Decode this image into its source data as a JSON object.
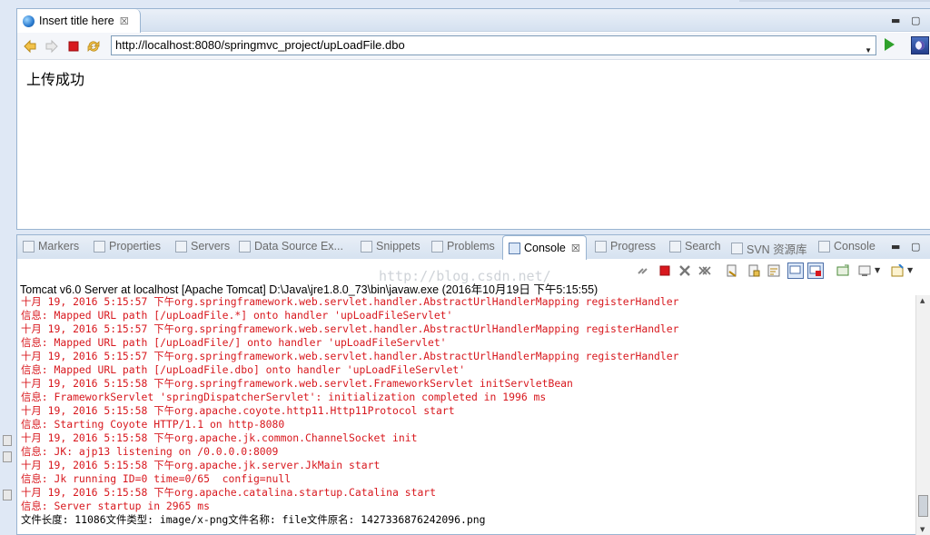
{
  "browser": {
    "tab_title": "Insert title here",
    "url": "http://localhost:8080/springmvc_project/upLoadFile.dbo",
    "page_text": "上传成功"
  },
  "views": {
    "tabs": [
      {
        "label": "Markers",
        "active": false
      },
      {
        "label": "Properties",
        "active": false
      },
      {
        "label": "Servers",
        "active": false
      },
      {
        "label": "Data Source Ex...",
        "active": false
      },
      {
        "label": "Snippets",
        "active": false
      },
      {
        "label": "Problems",
        "active": false
      },
      {
        "label": "Console",
        "active": true
      },
      {
        "label": "Progress",
        "active": false
      },
      {
        "label": "Search",
        "active": false
      },
      {
        "label": "SVN 资源库",
        "active": false
      },
      {
        "label": "Console",
        "active": false
      }
    ]
  },
  "console": {
    "header": "Tomcat v6.0 Server at localhost [Apache Tomcat] D:\\Java\\jre1.8.0_73\\bin\\javaw.exe (2016年10月19日 下午5:15:55)",
    "watermark": "http://blog.csdn.net/",
    "lines": [
      {
        "text": "十月 19, 2016 5:15:57 下午org.springframework.web.servlet.handler.AbstractUrlHandlerMapping registerHandler",
        "color": "red"
      },
      {
        "text": "信息: Mapped URL path [/upLoadFile.*] onto handler 'upLoadFileServlet'",
        "color": "red"
      },
      {
        "text": "十月 19, 2016 5:15:57 下午org.springframework.web.servlet.handler.AbstractUrlHandlerMapping registerHandler",
        "color": "red"
      },
      {
        "text": "信息: Mapped URL path [/upLoadFile/] onto handler 'upLoadFileServlet'",
        "color": "red"
      },
      {
        "text": "十月 19, 2016 5:15:57 下午org.springframework.web.servlet.handler.AbstractUrlHandlerMapping registerHandler",
        "color": "red"
      },
      {
        "text": "信息: Mapped URL path [/upLoadFile.dbo] onto handler 'upLoadFileServlet'",
        "color": "red"
      },
      {
        "text": "十月 19, 2016 5:15:58 下午org.springframework.web.servlet.FrameworkServlet initServletBean",
        "color": "red"
      },
      {
        "text": "信息: FrameworkServlet 'springDispatcherServlet': initialization completed in 1996 ms",
        "color": "red"
      },
      {
        "text": "十月 19, 2016 5:15:58 下午org.apache.coyote.http11.Http11Protocol start",
        "color": "red"
      },
      {
        "text": "信息: Starting Coyote HTTP/1.1 on http-8080",
        "color": "red"
      },
      {
        "text": "十月 19, 2016 5:15:58 下午org.apache.jk.common.ChannelSocket init",
        "color": "red"
      },
      {
        "text": "信息: JK: ajp13 listening on /0.0.0.0:8009",
        "color": "red"
      },
      {
        "text": "十月 19, 2016 5:15:58 下午org.apache.jk.server.JkMain start",
        "color": "red"
      },
      {
        "text": "信息: Jk running ID=0 time=0/65  config=null",
        "color": "red"
      },
      {
        "text": "十月 19, 2016 5:15:58 下午org.apache.catalina.startup.Catalina start",
        "color": "red"
      },
      {
        "text": "信息: Server startup in 2965 ms",
        "color": "red"
      },
      {
        "text": "文件长度: 11086文件类型: image/x-png文件名称: file文件原名: 1427336876242096.png",
        "color": "black"
      }
    ]
  }
}
